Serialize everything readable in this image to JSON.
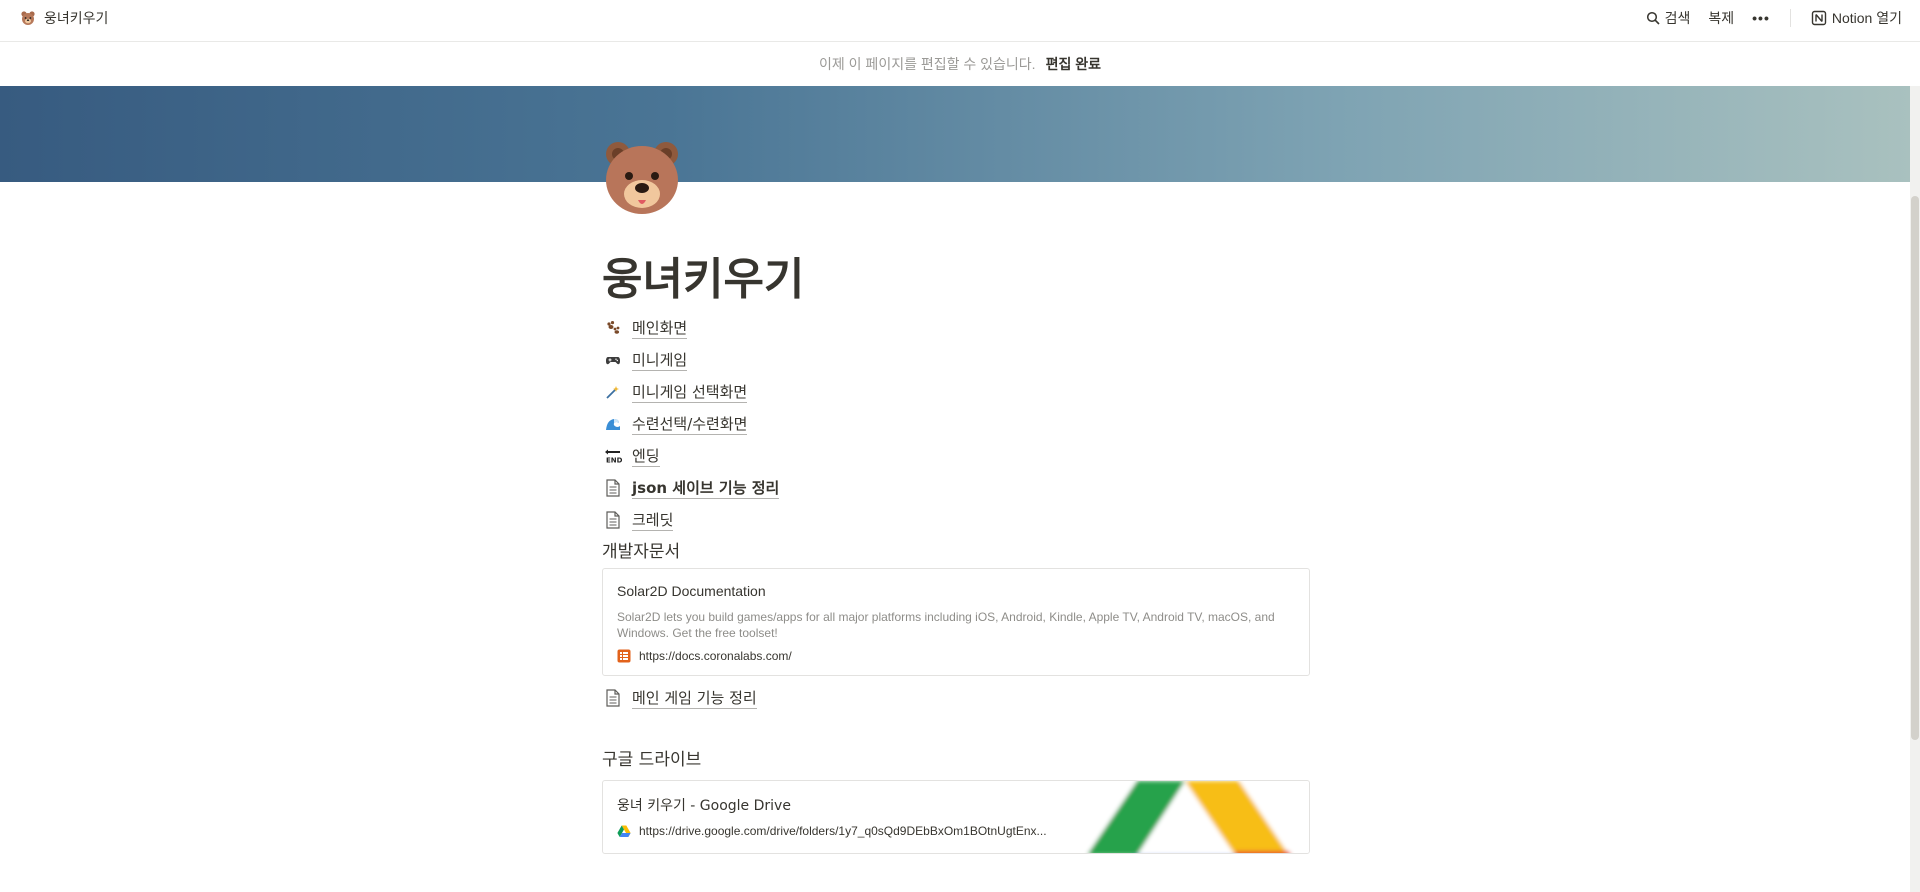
{
  "topbar": {
    "breadcrumb": "웅녀키우기",
    "search_label": "검색",
    "duplicate_label": "복제",
    "more_label": "•••",
    "open_notion_label": "Notion 열기"
  },
  "banner": {
    "message": "이제 이 페이지를 편집할 수 있습니다.",
    "done_label": "편집 완료"
  },
  "page": {
    "title": "웅녀키우기",
    "links": [
      {
        "icon": "paw-prints-icon",
        "label": "메인화면"
      },
      {
        "icon": "gamepad-icon",
        "label": "미니게임"
      },
      {
        "icon": "magic-wand-icon",
        "label": "미니게임 선택화면"
      },
      {
        "icon": "wave-icon",
        "label": "수련선택/수련화면"
      },
      {
        "icon": "end-arrow-icon",
        "label": "엔딩"
      },
      {
        "icon": "document-icon",
        "label": "json 세이브 기능 정리"
      },
      {
        "icon": "document-icon",
        "label": "크레딧"
      }
    ],
    "dev_docs_heading": "개발자문서",
    "bookmark": {
      "title": "Solar2D Documentation",
      "description": "Solar2D lets you build games/apps for all major platforms including iOS, Android, Kindle, Apple TV, Android TV, macOS, and Windows. Get the free toolset!",
      "url": "https://docs.coronalabs.com/"
    },
    "main_feature_link": "메인 게임 기능 정리",
    "drive_heading": "구글 드라이브",
    "drive_bookmark": {
      "title": "웅녀 키우기 - Google Drive",
      "url": "https://drive.google.com/drive/folders/1y7_q0sQd9DEbBxOm1BOtnUgtEnx..."
    }
  },
  "colors": {
    "text": "#37352f",
    "muted": "#9b9a97",
    "cover_start": "#375b80",
    "cover_end": "#a9c1bf"
  }
}
